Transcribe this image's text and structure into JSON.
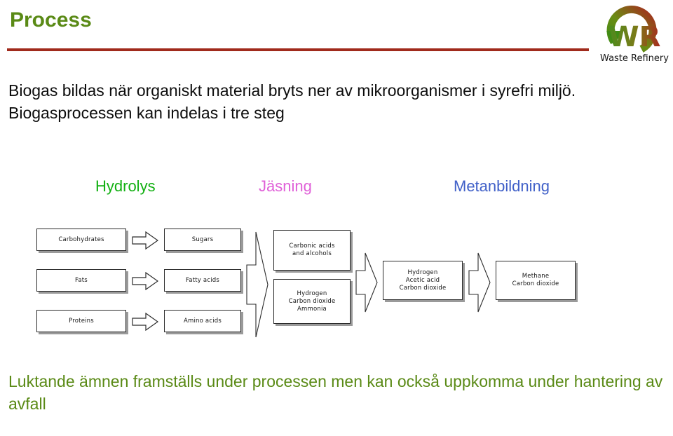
{
  "header": {
    "title": "Process",
    "rule_color": "#a02a1c",
    "title_color": "#5a8a16"
  },
  "logo": {
    "name": "waste-refinery-logo",
    "text": "Waste Refinery",
    "monogram": "WR",
    "green": "#4c8c1e",
    "red": "#a8281e"
  },
  "intro": {
    "text": "Biogas bildas när organiskt material bryts ner av mikroorganismer i syrefri miljö. Biogasprocessen kan indelas i tre steg"
  },
  "stages": [
    {
      "label": "Hydrolys",
      "color": "#12b012"
    },
    {
      "label": "Jäsning",
      "color": "#e060d8"
    },
    {
      "label": "Metanbildning",
      "color": "#4060c8"
    }
  ],
  "diagram": {
    "boxes": {
      "carbohydrates": "Carbohydrates",
      "fats": "Fats",
      "proteins": "Proteins",
      "sugars": "Sugars",
      "fatty_acids": "Fatty acids",
      "amino_acids": "Amino acids",
      "carbonic_acids": "Carbonic acids\nand alcohols",
      "hydrogen_co2_ammonia": "Hydrogen\nCarbon dioxide\nAmmonia",
      "hydrogen_acetic_co2": "Hydrogen\nAcetic acid\nCarbon dioxide",
      "methane_co2": "Methane\nCarbon dioxide"
    }
  },
  "footer": {
    "text": "Luktande ämnen framställs under processen men kan också  uppkomma under hantering av avfall",
    "color": "#5a8a16"
  }
}
